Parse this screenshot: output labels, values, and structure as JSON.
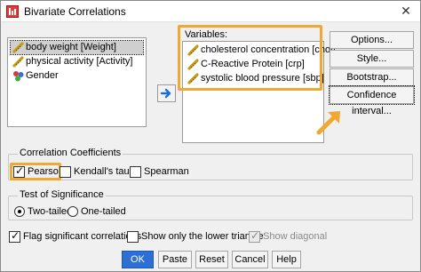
{
  "window": {
    "title": "Bivariate Correlations",
    "close_glyph": "✕"
  },
  "source_list": {
    "items": [
      {
        "label": "body weight [Weight]",
        "icon": "scale-ruler-icon",
        "selected": true
      },
      {
        "label": "physical activity [Activity]",
        "icon": "scale-ruler-icon",
        "selected": false
      },
      {
        "label": "Gender",
        "icon": "nominal-balls-icon",
        "selected": false
      }
    ]
  },
  "variables": {
    "label": "Variables:",
    "items": [
      {
        "label": "cholesterol concentration [chol]",
        "icon": "scale-ruler-icon"
      },
      {
        "label": "C-Reactive Protein [crp]",
        "icon": "scale-ruler-icon"
      },
      {
        "label": "systolic blood pressure [sbp]",
        "icon": "scale-ruler-icon"
      }
    ]
  },
  "side_buttons": {
    "options": "Options...",
    "style": "Style...",
    "bootstrap": "Bootstrap...",
    "confidence": "Confidence interval..."
  },
  "correlation": {
    "title": "Correlation Coefficients",
    "pearson": {
      "label": "Pearson",
      "checked": true
    },
    "kendall": {
      "label": "Kendall's tau-b",
      "checked": false
    },
    "spearman": {
      "label": "Spearman",
      "checked": false
    }
  },
  "significance": {
    "title": "Test of Significance",
    "two_tailed": {
      "label": "Two-tailed",
      "checked": true
    },
    "one_tailed": {
      "label": "One-tailed",
      "checked": false
    }
  },
  "flags": {
    "flag_sig": {
      "label": "Flag significant correlations",
      "checked": true
    },
    "lower_triangle": {
      "label": "Show only the lower triangle",
      "checked": false
    },
    "diagonal": {
      "label": "Show diagonal",
      "checked": true,
      "disabled": true
    }
  },
  "footer": {
    "ok": "OK",
    "paste": "Paste",
    "reset": "Reset",
    "cancel": "Cancel",
    "help": "Help"
  },
  "colors": {
    "highlight": "#f0a830",
    "primary_button": "#2e6fd6",
    "arrow": "#1c6fd6"
  }
}
